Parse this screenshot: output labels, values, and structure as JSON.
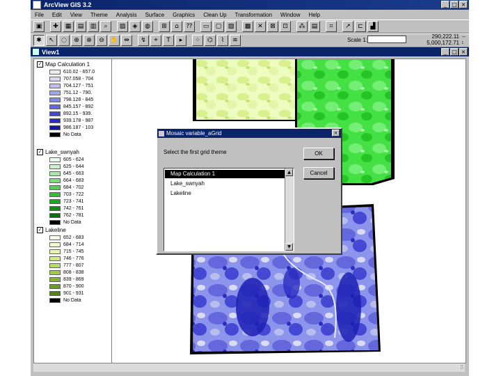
{
  "app": {
    "title": "ArcView GIS 3.2",
    "win_min": "_",
    "win_max": "□",
    "win_close": "×"
  },
  "menu": [
    "File",
    "Edit",
    "View",
    "Theme",
    "Analysis",
    "Surface",
    "Graphics",
    "Clean Up",
    "Transformation",
    "Window",
    "Help"
  ],
  "toolbar": {
    "scale_label": "Scale 1:",
    "scale_value": "",
    "coord_x": "290,222.11",
    "coord_y": "5,000,172.71",
    "coord_arrows": "↔\n↕"
  },
  "view": {
    "title": "View1"
  },
  "legend": {
    "themes": [
      {
        "name": "Map Calculation 1",
        "checked": true,
        "classes": [
          {
            "label": "610.02 - 657.0",
            "color": "#ececf8"
          },
          {
            "label": "707.058 - 704",
            "color": "#d6d8f4"
          },
          {
            "label": "704.127 - 751",
            "color": "#bcc0f0"
          },
          {
            "label": "751.12 - 790.",
            "color": "#a0a6ec"
          },
          {
            "label": "798.128 - 845",
            "color": "#8488e6"
          },
          {
            "label": "845.157 - 892",
            "color": "#6468dc"
          },
          {
            "label": "892.15 - 939.",
            "color": "#4448d2"
          },
          {
            "label": "939.178 - 987",
            "color": "#2a2cc2"
          },
          {
            "label": "986.187 - 103",
            "color": "#1416a8"
          },
          {
            "label": "No Data",
            "color": "#000000"
          }
        ]
      },
      {
        "name": "Lake_swnyah",
        "checked": true,
        "classes": [
          {
            "label": "605 - 624",
            "color": "#ecfcec"
          },
          {
            "label": "625 - 644",
            "color": "#c8f4c8"
          },
          {
            "label": "645 - 663",
            "color": "#a0eca0"
          },
          {
            "label": "664 - 683",
            "color": "#78e078"
          },
          {
            "label": "684 - 702",
            "color": "#4cd44c"
          },
          {
            "label": "703 - 722",
            "color": "#2cc42c"
          },
          {
            "label": "723 - 741",
            "color": "#14ac14"
          },
          {
            "label": "742 - 761",
            "color": "#0a900a"
          },
          {
            "label": "762 - 781",
            "color": "#047204"
          },
          {
            "label": "No Data",
            "color": "#000000"
          }
        ]
      },
      {
        "name": "Lakeline",
        "checked": true,
        "classes": [
          {
            "label": "652 - 683",
            "color": "#fcfce8"
          },
          {
            "label": "684 - 714",
            "color": "#f4fcc8"
          },
          {
            "label": "715 - 745",
            "color": "#e4f8a0"
          },
          {
            "label": "746 - 776",
            "color": "#ccf07c"
          },
          {
            "label": "777 - 807",
            "color": "#b4e05c"
          },
          {
            "label": "808 - 838",
            "color": "#9ccc40"
          },
          {
            "label": "839 - 869",
            "color": "#84b42c"
          },
          {
            "label": "870 - 900",
            "color": "#6c9c1c"
          },
          {
            "label": "901 - 931",
            "color": "#54840c"
          },
          {
            "label": "No Data",
            "color": "#000000"
          }
        ]
      }
    ]
  },
  "dialog": {
    "title": "Mosaic variable_aGrid",
    "prompt": "Select the first grid theme",
    "ok_label": "OK",
    "cancel_label": "Cancel",
    "items": [
      "Map Calculation 1",
      "Lake_swnyah",
      "Lakeline"
    ],
    "selected_index": 0
  }
}
